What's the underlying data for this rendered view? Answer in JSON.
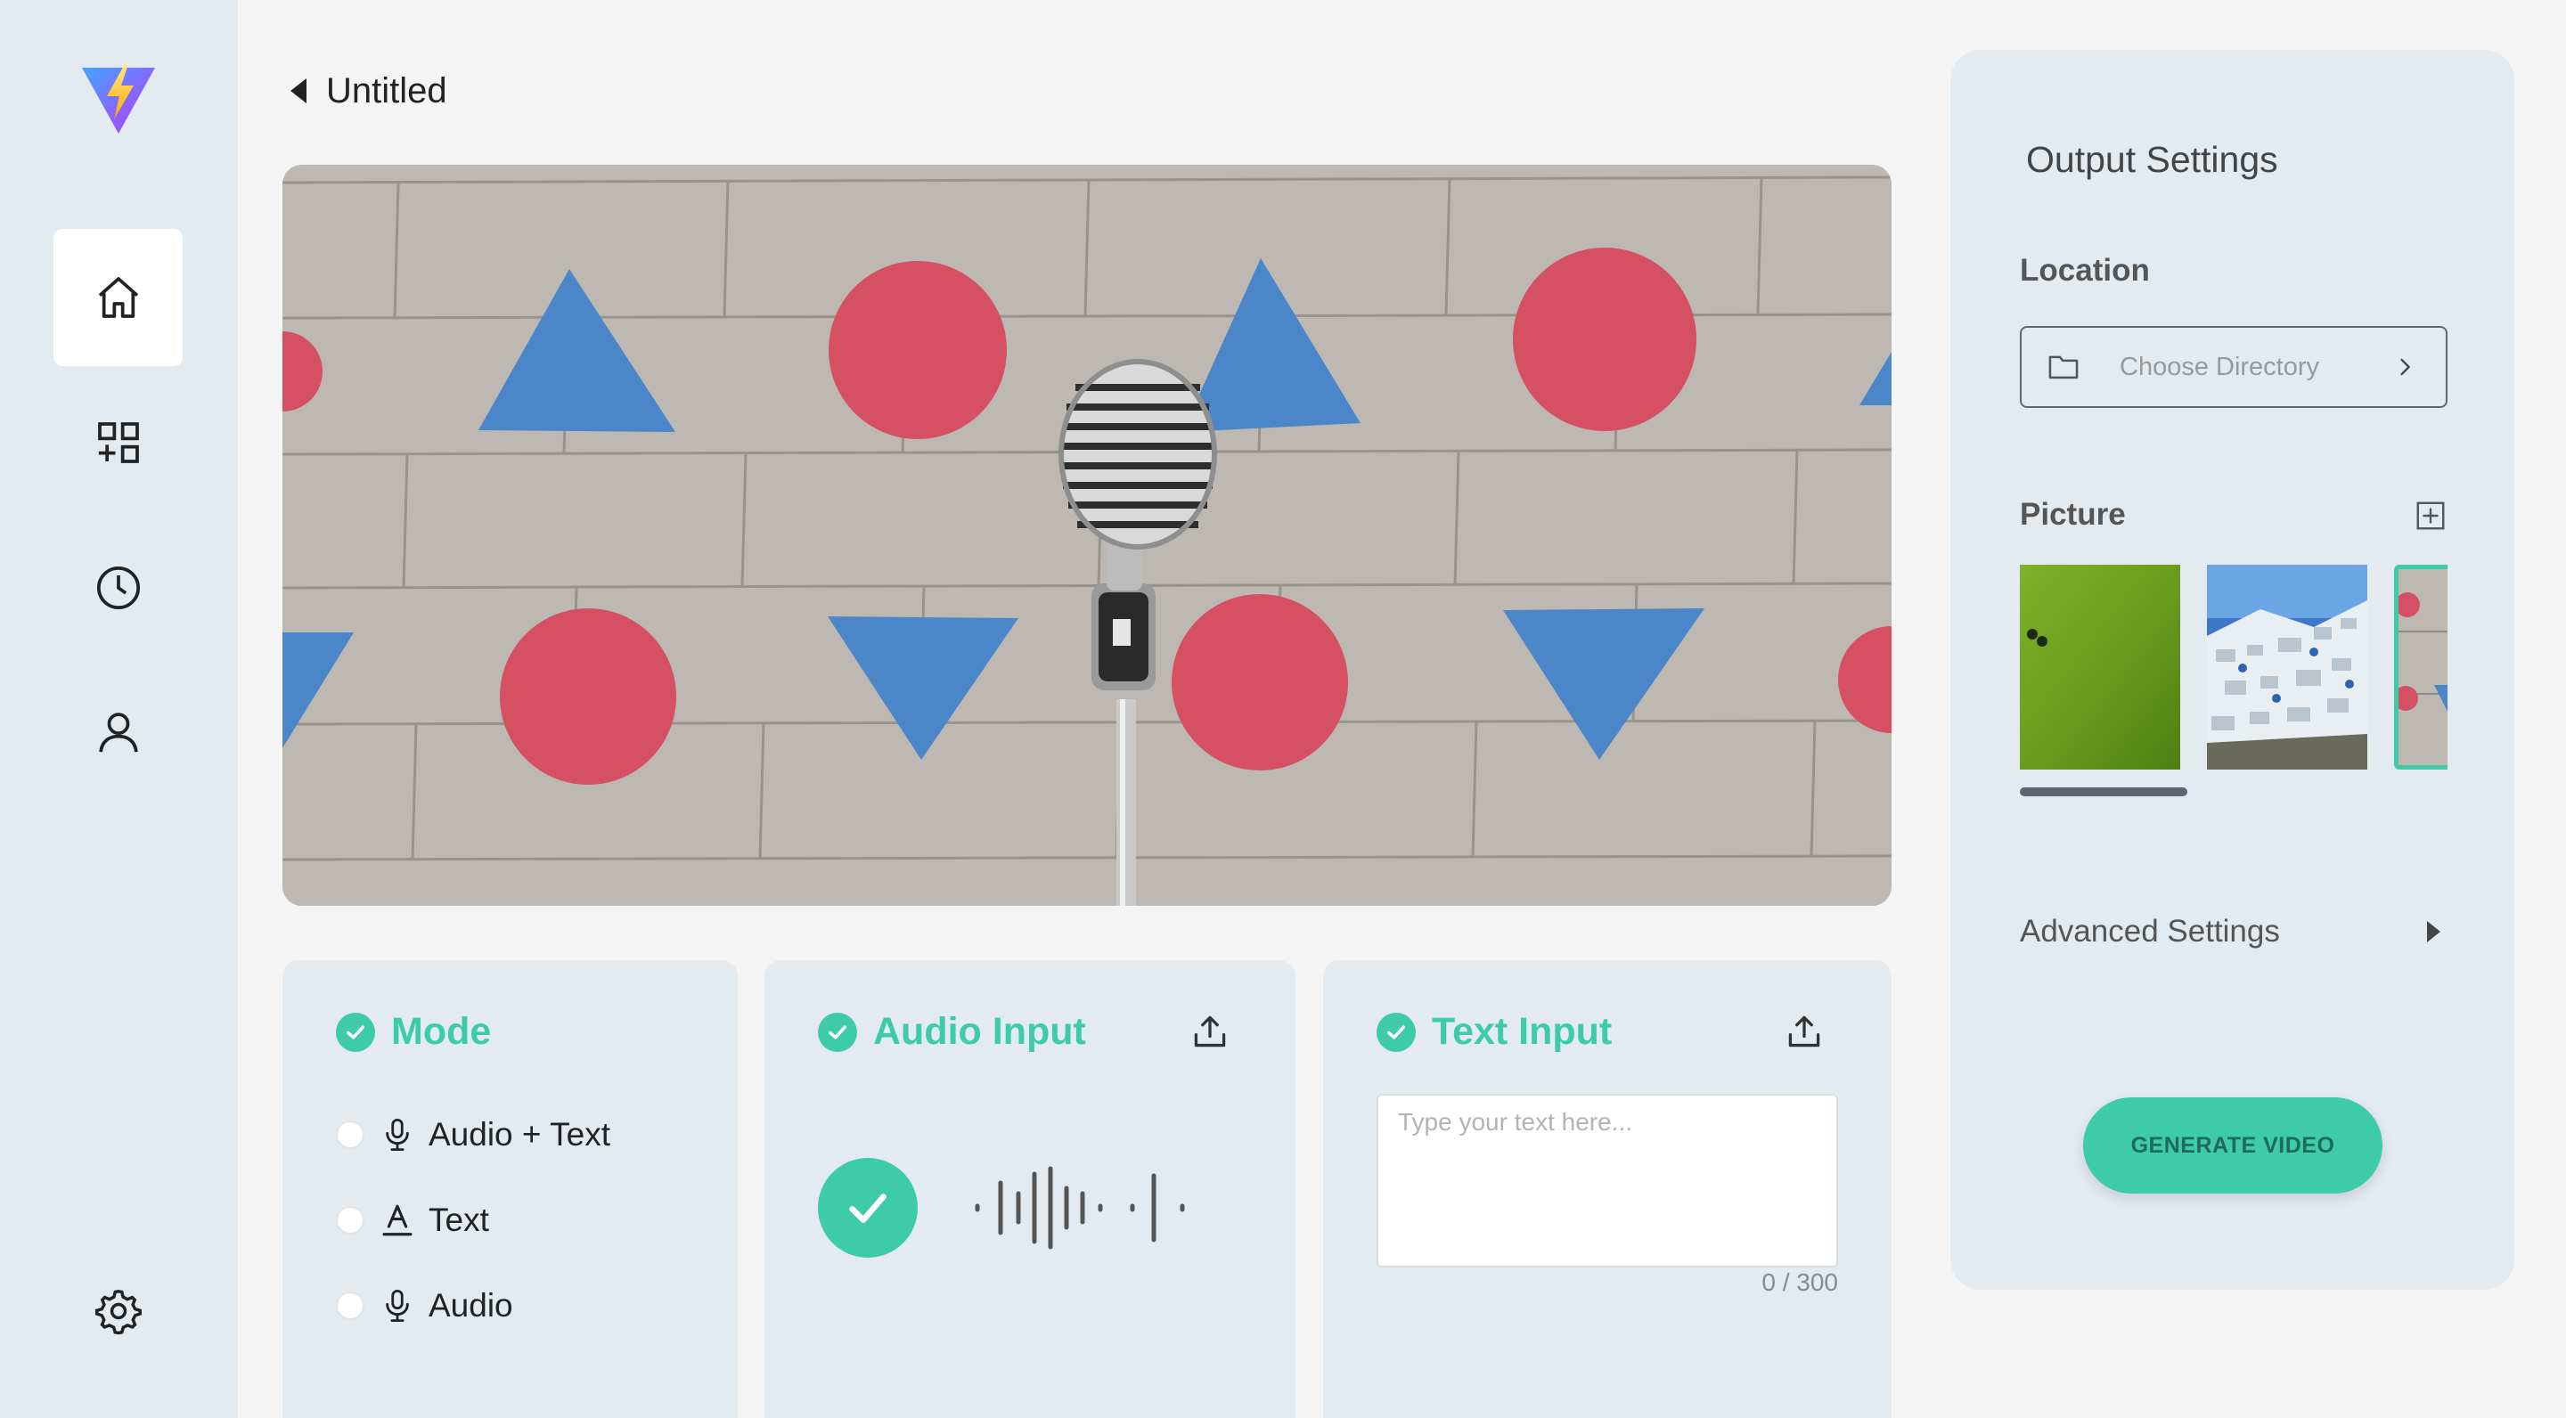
{
  "app": {
    "logo_icon": "lightning-v-logo"
  },
  "sidebar": {
    "items": [
      {
        "name": "home",
        "icon": "home-icon",
        "active": true
      },
      {
        "name": "dashboard",
        "icon": "grid-plus-icon",
        "active": false
      },
      {
        "name": "history",
        "icon": "clock-icon",
        "active": false
      },
      {
        "name": "profile",
        "icon": "user-icon",
        "active": false
      }
    ],
    "settings_icon": "gear-icon"
  },
  "header": {
    "title": "Untitled"
  },
  "mode": {
    "title": "Mode",
    "options": [
      {
        "label": "Audio + Text",
        "icon": "microphone-icon"
      },
      {
        "label": "Text",
        "icon": "text-a-icon"
      },
      {
        "label": "Audio",
        "icon": "microphone-icon"
      }
    ]
  },
  "audio_input": {
    "title": "Audio Input"
  },
  "text_input": {
    "title": "Text Input",
    "placeholder": "Type your text here...",
    "char_count": "0 / 300"
  },
  "output": {
    "title": "Output Settings",
    "location_label": "Location",
    "directory_placeholder": "Choose Directory",
    "picture_label": "Picture",
    "scroll_fraction": 0.4,
    "advanced_label": "Advanced Settings",
    "generate_label": "GENERATE VIDEO"
  },
  "colors": {
    "accent": "#3dcba8",
    "sidebar_bg": "#e4ebf0",
    "page_bg": "#f4f4f4",
    "triangle": "#4a86c8",
    "circle": "#d65064"
  }
}
